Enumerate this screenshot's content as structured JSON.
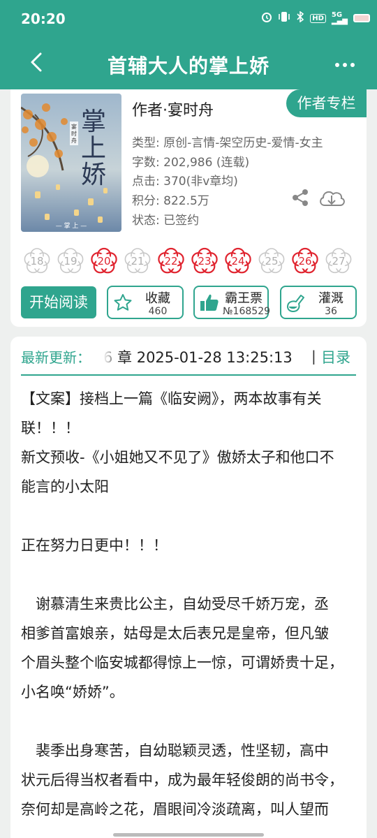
{
  "status_bar": {
    "time": "20:20",
    "network": "5G",
    "hd": "HD"
  },
  "app_bar": {
    "title": "首辅大人的掌上娇"
  },
  "book": {
    "author": "作者·宴时舟",
    "author_column_button": "作者专栏",
    "cover_title": "掌上娇",
    "cover_author": "宴时舟",
    "cover_caption": "— 掌 上 —",
    "meta": [
      "类型: 原创-言情-架空历史-爱情-女主",
      "字数: 202,986 (连载)",
      "点击: 370(非v章均)",
      "积分: 822.5万",
      "状态: 已签约"
    ]
  },
  "flowers": [
    {
      "label": "18",
      "active": false
    },
    {
      "label": "19",
      "active": false
    },
    {
      "label": "20",
      "active": true
    },
    {
      "label": "21",
      "active": false
    },
    {
      "label": "22",
      "active": true
    },
    {
      "label": "23",
      "active": true
    },
    {
      "label": "24",
      "active": true
    },
    {
      "label": "25",
      "active": false
    },
    {
      "label": "26",
      "active": true
    },
    {
      "label": "27",
      "active": false
    }
  ],
  "colors": {
    "accent": "#2fa58e",
    "flower_active": "#e0242f",
    "flower_inactive": "#c8c8c8"
  },
  "actions": {
    "start_reading": "开始阅读",
    "favorite": {
      "label": "收藏",
      "count": "460"
    },
    "overlord_ticket": {
      "label": "霸王票",
      "count": "№168529"
    },
    "irrigate": {
      "label": "灌溉",
      "count": "36"
    }
  },
  "latest": {
    "label": "最新更新：",
    "chapter": "6 章  2025-01-28 13:25:13",
    "separator": "|",
    "catalog": "目录"
  },
  "intro": [
    "【文案】接档上一篇《临安阙》，两本故事有关",
    "联！！！",
    "新文预收-《小姐她又不见了》傲娇太子和他口不",
    "能言的小太阳",
    "",
    "正在努力日更中！！！",
    "",
    "　谢慕清生来贵比公主，自幼受尽千娇万宠，丞",
    "相爹首富娘亲，姑母是太后表兄是皇帝，但凡皱",
    "个眉头整个临安城都得惊上一惊，可谓娇贵十足，",
    "小名唤“娇娇”。",
    "",
    "　裴季出身寒苦，自幼聪颖灵透，性坚韧，高中",
    "状元后得当权者看中，成为最年轻俊朗的尚书令，",
    "奈何却是高岭之花，眉眼间冷淡疏离，叫人望而"
  ]
}
